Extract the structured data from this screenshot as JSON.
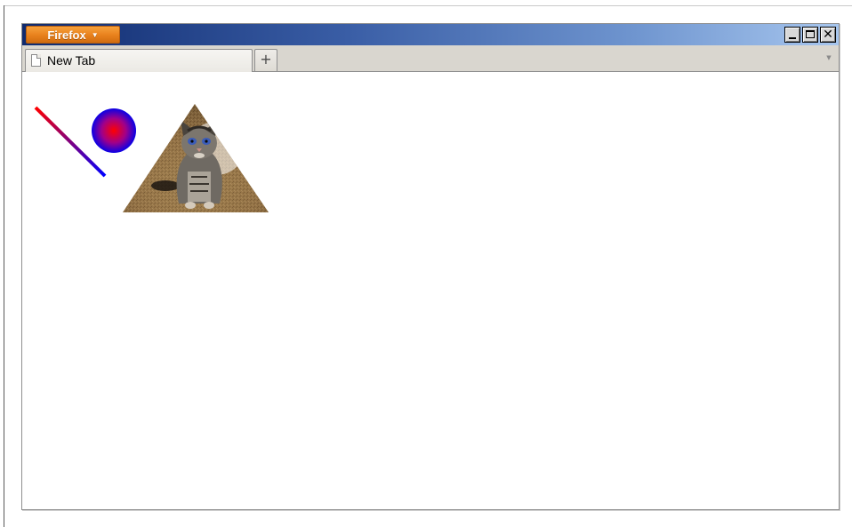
{
  "window": {
    "app_menu_label": "Firefox",
    "controls": {
      "minimize_icon": "minimize-icon",
      "maximize_icon": "maximize-icon",
      "close_icon": "close-icon",
      "close_glyph": "✕"
    },
    "title_gradient": [
      "#0f2a6e",
      "#3a5ea6",
      "#6f95cf",
      "#a7c6ee"
    ]
  },
  "tabs": [
    {
      "label": "New Tab",
      "icon": "blank-page-icon",
      "active": true
    }
  ],
  "tabstrip": {
    "new_tab_glyph": "+",
    "list_all_tabs_glyph": "▼"
  },
  "content": {
    "line": {
      "gradient_start": "#ff0000",
      "gradient_end": "#0000ff"
    },
    "circle": {
      "gradient_center": "#ff0000",
      "gradient_edge": "#0000ff"
    },
    "triangle": {
      "fill_subject": "kitten-photo"
    }
  }
}
